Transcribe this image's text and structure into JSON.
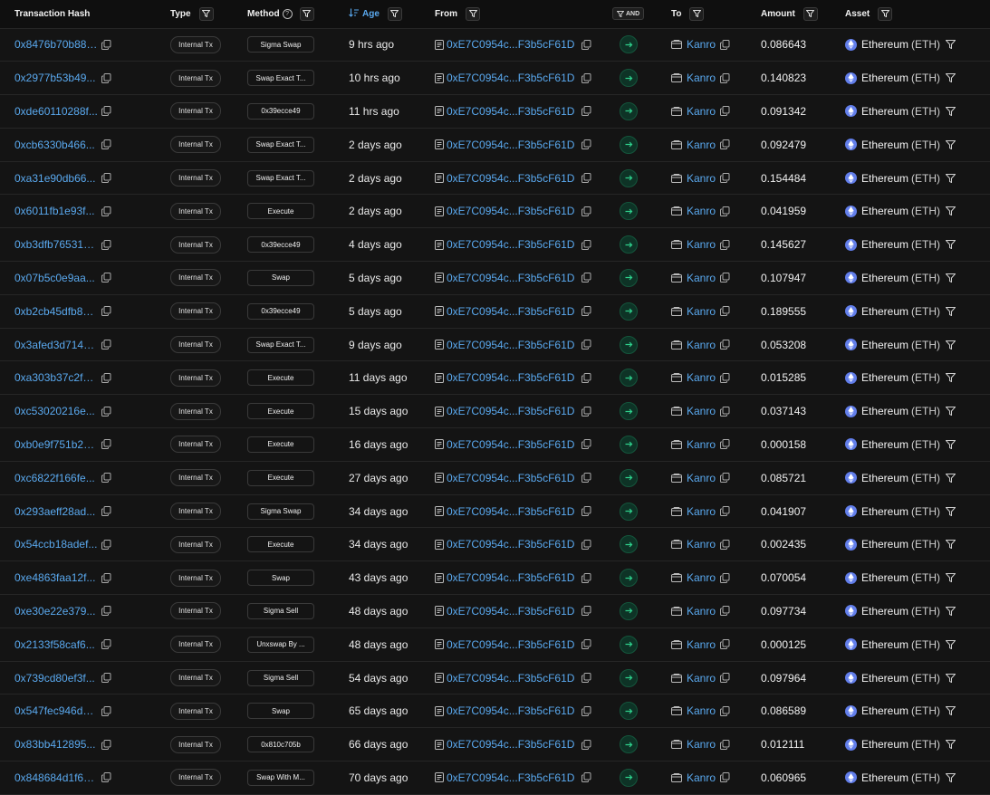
{
  "headers": {
    "hash": "Transaction Hash",
    "type": "Type",
    "method": "Method",
    "age": "Age",
    "from": "From",
    "and": "AND",
    "to": "To",
    "amount": "Amount",
    "asset": "Asset"
  },
  "icons": {
    "filter": "filter-icon",
    "copy": "copy-icon",
    "help": "help-icon",
    "sort": "sort-descending-icon",
    "direction": "arrow-right-icon",
    "contract": "document-icon",
    "wallet": "wallet-icon",
    "eth": "ethereum-icon"
  },
  "colors": {
    "link": "#5aa9ef",
    "direction_bg": "#0e3326",
    "eth": "#627eea"
  },
  "rows": [
    {
      "hash": "0x8476b70b88f...",
      "type": "Internal Tx",
      "method": "Sigma Swap",
      "age": "9 hrs ago",
      "from": "0xE7C0954c...F3b5cF61D",
      "to": "Kanro",
      "amount": "0.086643",
      "asset": "Ethereum",
      "symbol": "(ETH)"
    },
    {
      "hash": "0x2977b53b49...",
      "type": "Internal Tx",
      "method": "Swap Exact T...",
      "age": "10 hrs ago",
      "from": "0xE7C0954c...F3b5cF61D",
      "to": "Kanro",
      "amount": "0.140823",
      "asset": "Ethereum",
      "symbol": "(ETH)"
    },
    {
      "hash": "0xde60110288f...",
      "type": "Internal Tx",
      "method": "0x39ecce49",
      "age": "11 hrs ago",
      "from": "0xE7C0954c...F3b5cF61D",
      "to": "Kanro",
      "amount": "0.091342",
      "asset": "Ethereum",
      "symbol": "(ETH)"
    },
    {
      "hash": "0xcb6330b466...",
      "type": "Internal Tx",
      "method": "Swap Exact T...",
      "age": "2 days ago",
      "from": "0xE7C0954c...F3b5cF61D",
      "to": "Kanro",
      "amount": "0.092479",
      "asset": "Ethereum",
      "symbol": "(ETH)"
    },
    {
      "hash": "0xa31e90db66...",
      "type": "Internal Tx",
      "method": "Swap Exact T...",
      "age": "2 days ago",
      "from": "0xE7C0954c...F3b5cF61D",
      "to": "Kanro",
      "amount": "0.154484",
      "asset": "Ethereum",
      "symbol": "(ETH)"
    },
    {
      "hash": "0x6011fb1e93f...",
      "type": "Internal Tx",
      "method": "Execute",
      "age": "2 days ago",
      "from": "0xE7C0954c...F3b5cF61D",
      "to": "Kanro",
      "amount": "0.041959",
      "asset": "Ethereum",
      "symbol": "(ETH)"
    },
    {
      "hash": "0xb3dfb765318...",
      "type": "Internal Tx",
      "method": "0x39ecce49",
      "age": "4 days ago",
      "from": "0xE7C0954c...F3b5cF61D",
      "to": "Kanro",
      "amount": "0.145627",
      "asset": "Ethereum",
      "symbol": "(ETH)"
    },
    {
      "hash": "0x07b5c0e9aa...",
      "type": "Internal Tx",
      "method": "Swap",
      "age": "5 days ago",
      "from": "0xE7C0954c...F3b5cF61D",
      "to": "Kanro",
      "amount": "0.107947",
      "asset": "Ethereum",
      "symbol": "(ETH)"
    },
    {
      "hash": "0xb2cb45dfb83...",
      "type": "Internal Tx",
      "method": "0x39ecce49",
      "age": "5 days ago",
      "from": "0xE7C0954c...F3b5cF61D",
      "to": "Kanro",
      "amount": "0.189555",
      "asset": "Ethereum",
      "symbol": "(ETH)"
    },
    {
      "hash": "0x3afed3d7148...",
      "type": "Internal Tx",
      "method": "Swap Exact T...",
      "age": "9 days ago",
      "from": "0xE7C0954c...F3b5cF61D",
      "to": "Kanro",
      "amount": "0.053208",
      "asset": "Ethereum",
      "symbol": "(ETH)"
    },
    {
      "hash": "0xa303b37c2f9...",
      "type": "Internal Tx",
      "method": "Execute",
      "age": "11 days ago",
      "from": "0xE7C0954c...F3b5cF61D",
      "to": "Kanro",
      "amount": "0.015285",
      "asset": "Ethereum",
      "symbol": "(ETH)"
    },
    {
      "hash": "0xc53020216e...",
      "type": "Internal Tx",
      "method": "Execute",
      "age": "15 days ago",
      "from": "0xE7C0954c...F3b5cF61D",
      "to": "Kanro",
      "amount": "0.037143",
      "asset": "Ethereum",
      "symbol": "(ETH)"
    },
    {
      "hash": "0xb0e9f751b2c...",
      "type": "Internal Tx",
      "method": "Execute",
      "age": "16 days ago",
      "from": "0xE7C0954c...F3b5cF61D",
      "to": "Kanro",
      "amount": "0.000158",
      "asset": "Ethereum",
      "symbol": "(ETH)"
    },
    {
      "hash": "0xc6822f166fe...",
      "type": "Internal Tx",
      "method": "Execute",
      "age": "27 days ago",
      "from": "0xE7C0954c...F3b5cF61D",
      "to": "Kanro",
      "amount": "0.085721",
      "asset": "Ethereum",
      "symbol": "(ETH)"
    },
    {
      "hash": "0x293aeff28ad...",
      "type": "Internal Tx",
      "method": "Sigma Swap",
      "age": "34 days ago",
      "from": "0xE7C0954c...F3b5cF61D",
      "to": "Kanro",
      "amount": "0.041907",
      "asset": "Ethereum",
      "symbol": "(ETH)"
    },
    {
      "hash": "0x54ccb18adef...",
      "type": "Internal Tx",
      "method": "Execute",
      "age": "34 days ago",
      "from": "0xE7C0954c...F3b5cF61D",
      "to": "Kanro",
      "amount": "0.002435",
      "asset": "Ethereum",
      "symbol": "(ETH)"
    },
    {
      "hash": "0xe4863faa12f...",
      "type": "Internal Tx",
      "method": "Swap",
      "age": "43 days ago",
      "from": "0xE7C0954c...F3b5cF61D",
      "to": "Kanro",
      "amount": "0.070054",
      "asset": "Ethereum",
      "symbol": "(ETH)"
    },
    {
      "hash": "0xe30e22e379...",
      "type": "Internal Tx",
      "method": "Sigma Sell",
      "age": "48 days ago",
      "from": "0xE7C0954c...F3b5cF61D",
      "to": "Kanro",
      "amount": "0.097734",
      "asset": "Ethereum",
      "symbol": "(ETH)"
    },
    {
      "hash": "0x2133f58caf6...",
      "type": "Internal Tx",
      "method": "Unxswap By ...",
      "age": "48 days ago",
      "from": "0xE7C0954c...F3b5cF61D",
      "to": "Kanro",
      "amount": "0.000125",
      "asset": "Ethereum",
      "symbol": "(ETH)"
    },
    {
      "hash": "0x739cd80ef3f...",
      "type": "Internal Tx",
      "method": "Sigma Sell",
      "age": "54 days ago",
      "from": "0xE7C0954c...F3b5cF61D",
      "to": "Kanro",
      "amount": "0.097964",
      "asset": "Ethereum",
      "symbol": "(ETH)"
    },
    {
      "hash": "0x547fec946d5...",
      "type": "Internal Tx",
      "method": "Swap",
      "age": "65 days ago",
      "from": "0xE7C0954c...F3b5cF61D",
      "to": "Kanro",
      "amount": "0.086589",
      "asset": "Ethereum",
      "symbol": "(ETH)"
    },
    {
      "hash": "0x83bb412895...",
      "type": "Internal Tx",
      "method": "0x810c705b",
      "age": "66 days ago",
      "from": "0xE7C0954c...F3b5cF61D",
      "to": "Kanro",
      "amount": "0.012111",
      "asset": "Ethereum",
      "symbol": "(ETH)"
    },
    {
      "hash": "0x848684d1f62...",
      "type": "Internal Tx",
      "method": "Swap With M...",
      "age": "70 days ago",
      "from": "0xE7C0954c...F3b5cF61D",
      "to": "Kanro",
      "amount": "0.060965",
      "asset": "Ethereum",
      "symbol": "(ETH)"
    }
  ]
}
